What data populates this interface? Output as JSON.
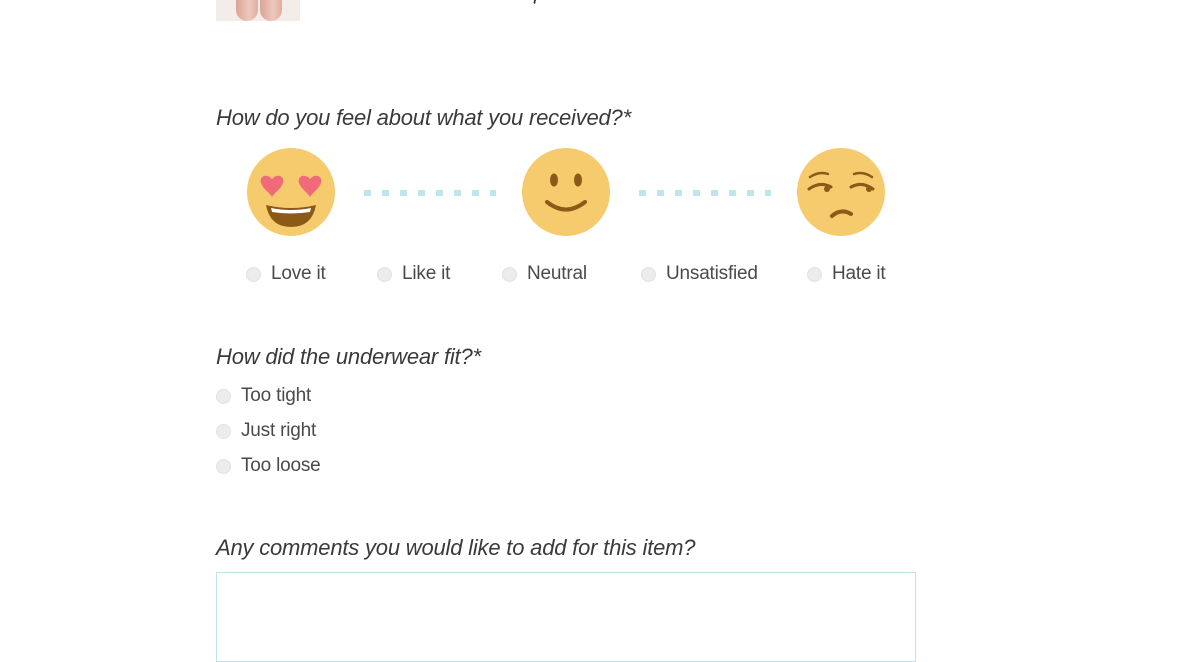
{
  "product": {
    "image_icon": "product-photo"
  },
  "feeling_question": {
    "label": "How do you feel about what you received?*",
    "emojis": [
      "heart-eyes-emoji-icon",
      "smile-emoji-icon",
      "unamused-emoji-icon"
    ],
    "options": [
      "Love it",
      "Like it",
      "Neutral",
      "Unsatisfied",
      "Hate it"
    ]
  },
  "fit_question": {
    "label": "How did the underwear fit?*",
    "options": [
      "Too tight",
      "Just right",
      "Too loose"
    ]
  },
  "comment_question": {
    "label": "Any comments you would like to add for this item?",
    "value": ""
  },
  "colors": {
    "emoji_face": "#f6cb6d",
    "emoji_feature": "#8a5a16",
    "hearts": "#f06a7a",
    "dashes": "#bfe6ec",
    "radio": "#ececec",
    "textarea_border": "#bfe3ea"
  }
}
